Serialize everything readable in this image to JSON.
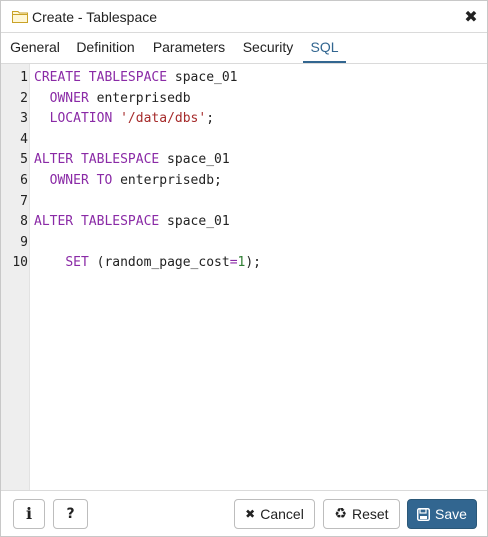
{
  "dialog": {
    "title": "Create - Tablespace"
  },
  "tabs": [
    {
      "label": "General",
      "active": false
    },
    {
      "label": "Definition",
      "active": false
    },
    {
      "label": "Parameters",
      "active": false
    },
    {
      "label": "Security",
      "active": false
    },
    {
      "label": "SQL",
      "active": true
    }
  ],
  "editor": {
    "line_numbers": [
      "1",
      "2",
      "3",
      "4",
      "5",
      "6",
      "7",
      "8",
      "9",
      "10"
    ],
    "lines": [
      [
        {
          "t": "CREATE TABLESPACE",
          "c": "kw"
        },
        {
          "t": " space_01",
          "c": ""
        }
      ],
      [
        {
          "t": "  ",
          "c": ""
        },
        {
          "t": "OWNER",
          "c": "kw"
        },
        {
          "t": " enterprisedb",
          "c": ""
        }
      ],
      [
        {
          "t": "  ",
          "c": ""
        },
        {
          "t": "LOCATION",
          "c": "kw"
        },
        {
          "t": " ",
          "c": ""
        },
        {
          "t": "'/data/dbs'",
          "c": "str"
        },
        {
          "t": ";",
          "c": ""
        }
      ],
      [],
      [
        {
          "t": "ALTER TABLESPACE",
          "c": "kw"
        },
        {
          "t": " space_01",
          "c": ""
        }
      ],
      [
        {
          "t": "  ",
          "c": ""
        },
        {
          "t": "OWNER TO",
          "c": "kw"
        },
        {
          "t": " enterprisedb;",
          "c": ""
        }
      ],
      [],
      [
        {
          "t": "ALTER TABLESPACE",
          "c": "kw"
        },
        {
          "t": " space_01",
          "c": ""
        }
      ],
      [],
      [
        {
          "t": "    ",
          "c": ""
        },
        {
          "t": "SET",
          "c": "kw"
        },
        {
          "t": " (random_page_cost",
          "c": ""
        },
        {
          "t": "=",
          "c": "kw"
        },
        {
          "t": "1",
          "c": "num"
        },
        {
          "t": ");",
          "c": ""
        }
      ]
    ]
  },
  "footer": {
    "info_label": "i",
    "help_label": "?",
    "cancel_label": "Cancel",
    "reset_label": "Reset",
    "save_label": "Save"
  },
  "colors": {
    "accent": "#326690",
    "keyword": "#8a2aa6",
    "string": "#a52a2a",
    "number": "#2e7d32"
  },
  "icons": {
    "title": "folder-icon",
    "close": "close-icon",
    "cancel": "x-icon",
    "reset": "recycle-icon",
    "save": "floppy-disk-icon"
  }
}
